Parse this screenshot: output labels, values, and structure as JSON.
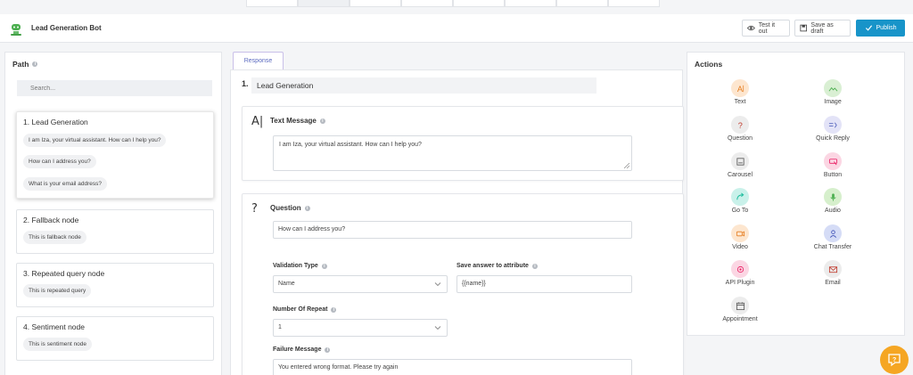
{
  "header": {
    "bot_title": "Lead Generation Bot",
    "test_label": "Test it out",
    "draft_label": "Save as draft",
    "publish_label": "Publish"
  },
  "path": {
    "title": "Path",
    "search_placeholder": "Search...",
    "nodes": [
      {
        "title": "1. Lead Generation",
        "messages": [
          "I am Iza, your virtual assistant. How can I help you?",
          "How can I address you?",
          "What is your email address?"
        ]
      },
      {
        "title": "2. Fallback node",
        "messages": [
          "This is fallback node"
        ]
      },
      {
        "title": "3. Repeated query node",
        "messages": [
          "This is repeated query"
        ]
      },
      {
        "title": "4. Sentiment node",
        "messages": [
          "This is sentiment node"
        ]
      }
    ]
  },
  "response": {
    "tab_label": "Response",
    "step_number": "1.",
    "step_name": "Lead Generation",
    "text_card": {
      "title": "Text Message",
      "value": "I am Iza, your virtual assistant. How can I help you?"
    },
    "question_card": {
      "title": "Question",
      "question_value": "How can I address you?",
      "validation_label": "Validation Type",
      "validation_value": "Name",
      "save_label": "Save answer to attribute",
      "save_value": "{{name}}",
      "repeat_label": "Number Of Repeat",
      "repeat_value": "1",
      "failure_label": "Failure Message",
      "failure_value": "You entered wrong format. Please try again"
    }
  },
  "actions": {
    "title": "Actions",
    "items": [
      {
        "label": "Text",
        "icon": "text-icon",
        "color": "#fde6cf"
      },
      {
        "label": "Image",
        "icon": "image-icon",
        "color": "#d9efd3"
      },
      {
        "label": "Question",
        "icon": "question-icon",
        "color": "#ececec"
      },
      {
        "label": "Quick Reply",
        "icon": "quick-reply-icon",
        "color": "#e3e3f7"
      },
      {
        "label": "Carousel",
        "icon": "carousel-icon",
        "color": "#ececec"
      },
      {
        "label": "Button",
        "icon": "button-icon",
        "color": "#fbd6e3"
      },
      {
        "label": "Go To",
        "icon": "goto-icon",
        "color": "#c9f1ea"
      },
      {
        "label": "Audio",
        "icon": "audio-icon",
        "color": "#d6efcc"
      },
      {
        "label": "Video",
        "icon": "video-icon",
        "color": "#fde6cf"
      },
      {
        "label": "Chat Transfer",
        "icon": "chat-transfer-icon",
        "color": "#d5dcf6"
      },
      {
        "label": "API Plugin",
        "icon": "api-plugin-icon",
        "color": "#fbd6e3"
      },
      {
        "label": "Email",
        "icon": "email-icon",
        "color": "#ececec"
      },
      {
        "label": "Appointment",
        "icon": "appointment-icon",
        "color": "#ececec"
      }
    ]
  }
}
